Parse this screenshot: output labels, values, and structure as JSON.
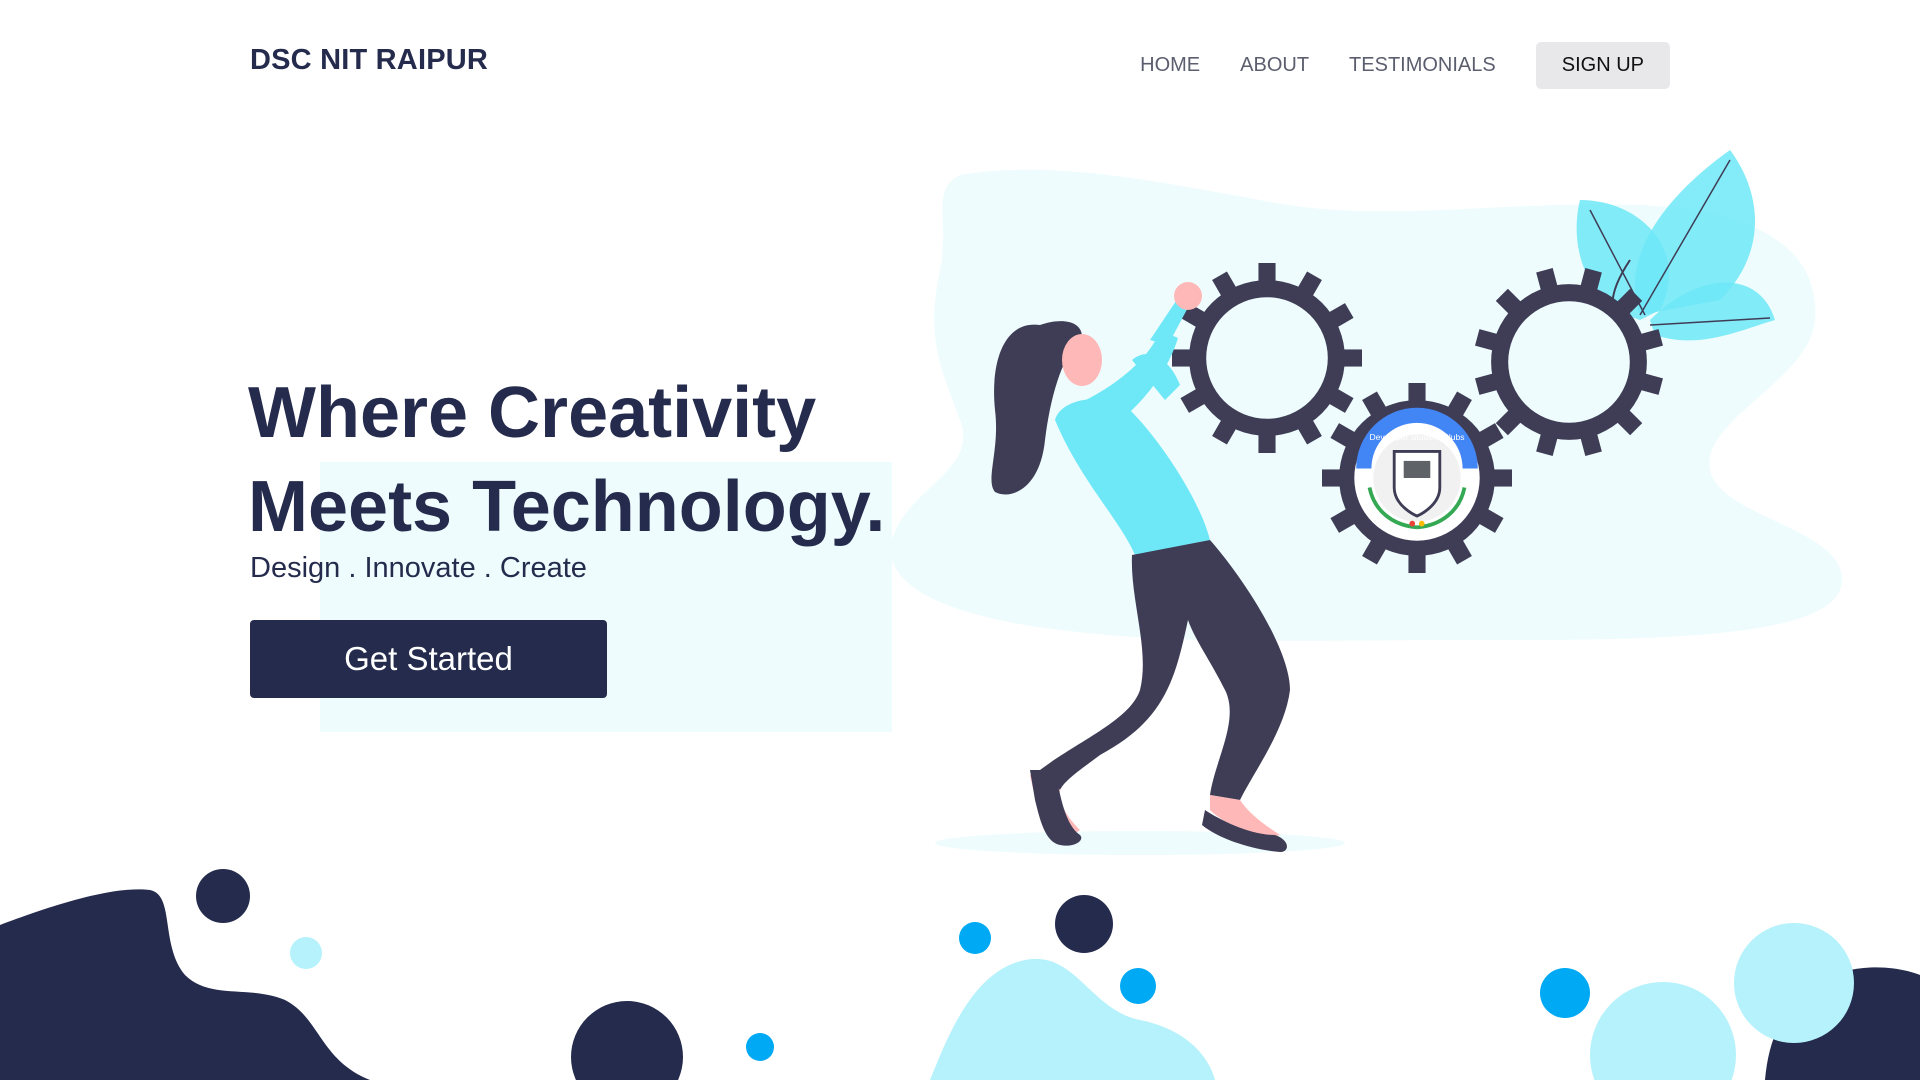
{
  "nav": {
    "brand": "DSC NIT RAIPUR",
    "links": [
      "HOME",
      "ABOUT",
      "TESTIMONIALS"
    ],
    "signup": "SIGN UP"
  },
  "hero": {
    "title_line1": "Where Creativity",
    "title_line2": "Meets Technology.",
    "tagline": "Design . Innovate . Create",
    "cta": "Get Started"
  },
  "badge": {
    "text": "Developer Student Clubs"
  },
  "colors": {
    "navy": "#252b4d",
    "light_cyan": "#eefcfd",
    "cyan": "#6ee8f7",
    "blue_dot": "#00a9f4",
    "pale_blue": "#b5f2fb",
    "gear": "#3f3d56"
  },
  "icons": [
    "gear-icon",
    "leaf-icon",
    "dsc-badge-icon"
  ]
}
